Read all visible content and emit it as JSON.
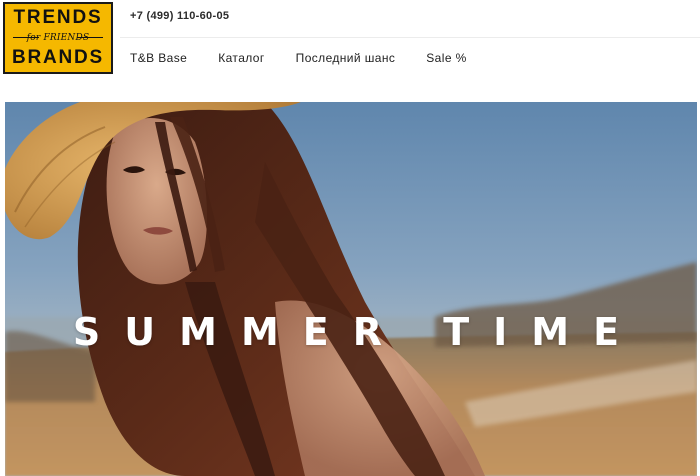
{
  "logo": {
    "line1": "TRENDS",
    "script": "for FRIENDS",
    "line2": "BRANDS",
    "background": "#f5b800"
  },
  "header": {
    "phone": "+7 (499) 110-60-05"
  },
  "nav": {
    "items": [
      {
        "label": "T&B Base"
      },
      {
        "label": "Каталог"
      },
      {
        "label": "Последний шанс"
      },
      {
        "label": "Sale %"
      }
    ]
  },
  "hero": {
    "title": "SUMMER TIME",
    "image": "woman-in-straw-hat-photo",
    "sky_color": "#6f8fb0",
    "ground_color": "#b08458"
  }
}
